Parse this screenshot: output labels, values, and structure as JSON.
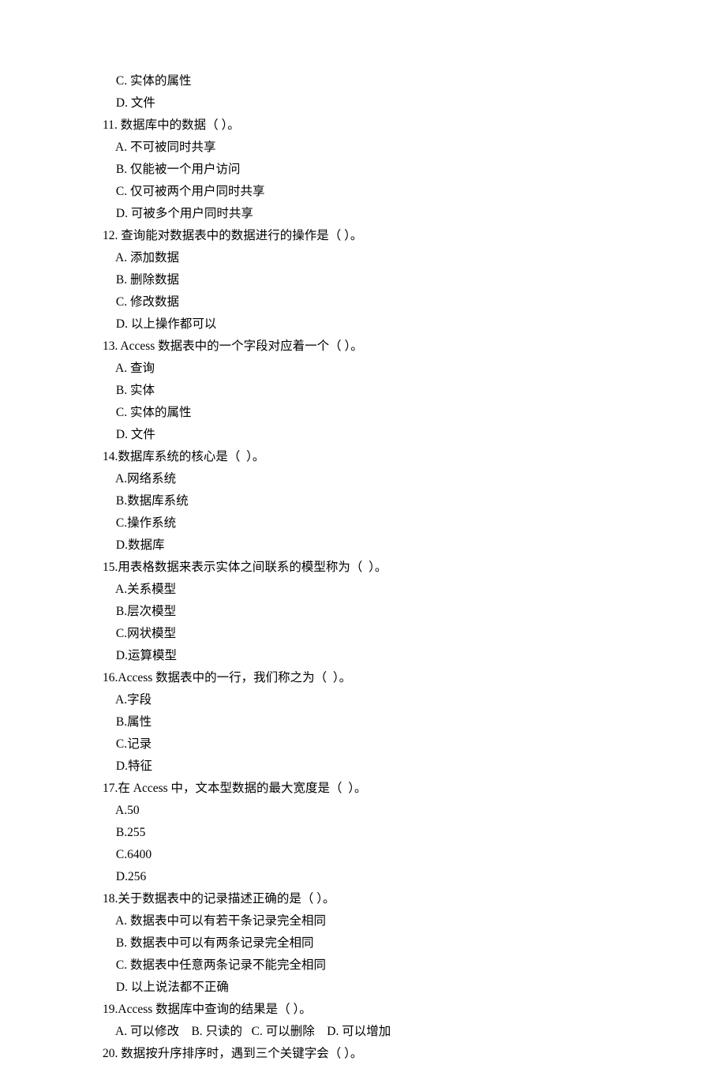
{
  "pre": {
    "c": " C. 实体的属性",
    "d": " D. 文件"
  },
  "q11": {
    "stem": "11. 数据库中的数据（ ）。",
    "a": " A. 不可被同时共享",
    "b": " B. 仅能被一个用户访问",
    "c": " C. 仅可被两个用户同时共享",
    "d": " D. 可被多个用户同时共享"
  },
  "q12": {
    "stem": "12. 查询能对数据表中的数据进行的操作是（ ）。",
    "a": " A. 添加数据",
    "b": " B. 删除数据",
    "c": " C. 修改数据",
    "d": " D. 以上操作都可以"
  },
  "q13": {
    "stem": "13. Access 数据表中的一个字段对应着一个（ ）。",
    "a": " A. 查询",
    "b": " B. 实体",
    "c": " C. 实体的属性",
    "d": " D. 文件"
  },
  "q14": {
    "stem": "14.数据库系统的核心是（  ）。",
    "a": " A.网络系统",
    "b": " B.数据库系统",
    "c": " C.操作系统",
    "d": " D.数据库"
  },
  "q15": {
    "stem": "15.用表格数据来表示实体之间联系的模型称为（  ）。",
    "a": " A.关系模型",
    "b": " B.层次模型",
    "c": " C.网状模型",
    "d": " D.运算模型"
  },
  "q16": {
    "stem": "16.Access 数据表中的一行，我们称之为（  ）。",
    "a": " A.字段",
    "b": " B.属性",
    "c": " C.记录",
    "d": " D.特征"
  },
  "q17": {
    "stem": "17.在 Access 中，文本型数据的最大宽度是（  ）。",
    "a": " A.50",
    "b": " B.255",
    "c": " C.6400",
    "d": " D.256"
  },
  "q18": {
    "stem": "18.关于数据表中的记录描述正确的是（ ）。",
    "a": " A. 数据表中可以有若干条记录完全相同",
    "b": " B. 数据表中可以有两条记录完全相同",
    "c": " C. 数据表中任意两条记录不能完全相同",
    "d": " D. 以上说法都不正确"
  },
  "q19": {
    "stem": "19.Access 数据库中查询的结果是（ ）。",
    "opts": " A. 可以修改    B. 只读的   C. 可以删除    D. 可以增加"
  },
  "q20": {
    "stem": "20. 数据按升序排序时，遇到三个关键字会（ ）。"
  }
}
